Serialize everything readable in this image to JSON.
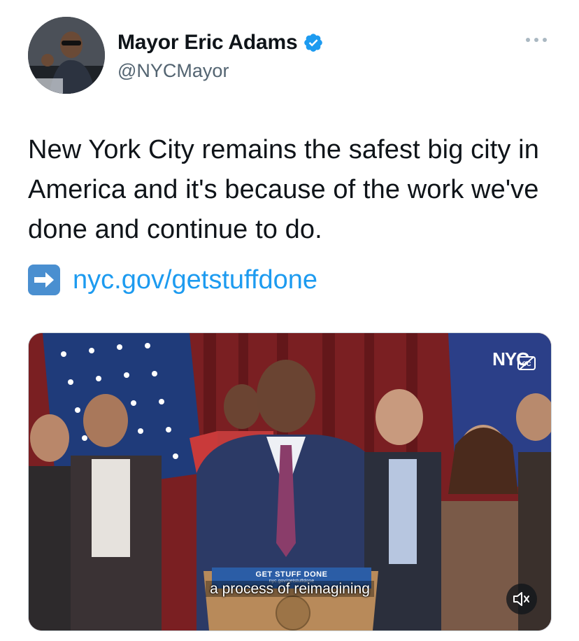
{
  "tweet": {
    "display_name": "Mayor Eric Adams",
    "handle": "@NYCMayor",
    "verified": true,
    "text": "New York City remains the safest big city in America and it's because of the work we've done and continue to do.",
    "link_emoji": "right-arrow-emoji",
    "link_text": "nyc.gov/getstuffdone"
  },
  "media": {
    "logo_text": "NYC",
    "podium_title": "GET STUFF DONE",
    "podium_url": "nyc.gov/getstuffdone",
    "podium_tag": "#GSD",
    "caption": "a process of reimagining",
    "icons": [
      "cc-icon",
      "mute-icon"
    ]
  },
  "colors": {
    "link": "#1d9bf0",
    "verified": "#1d9bf0",
    "handle": "#536471",
    "text": "#0f1419"
  }
}
